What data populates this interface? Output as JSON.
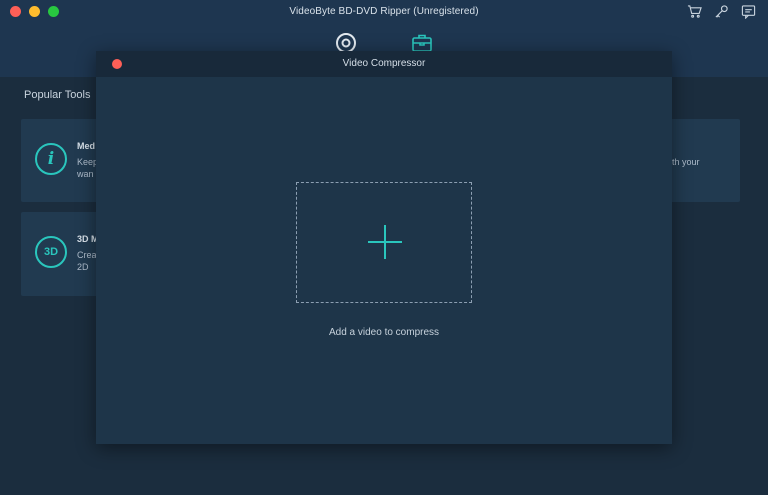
{
  "window": {
    "title": "VideoByte BD-DVD Ripper (Unregistered)"
  },
  "top_icons": [
    "cart-icon",
    "key-icon",
    "feedback-icon"
  ],
  "nav_tabs": [
    "disc-icon",
    "toolbox-icon"
  ],
  "background": {
    "section_title": "Popular Tools",
    "cards": [
      {
        "icon": "info-icon",
        "icon_glyph": "i",
        "title": "Med",
        "desc": "Keep\nwan",
        "right_text": "th your"
      },
      {
        "icon": "3d-icon",
        "icon_glyph": "3D",
        "title": "3D M",
        "desc": "Crea\n2D"
      }
    ]
  },
  "modal": {
    "title": "Video Compressor",
    "drop_hint": "Add a video to compress"
  },
  "colors": {
    "accent": "#2ac6bd",
    "close_red": "#fe5f57",
    "traffic_yellow": "#febc2e",
    "traffic_green": "#28c840"
  }
}
